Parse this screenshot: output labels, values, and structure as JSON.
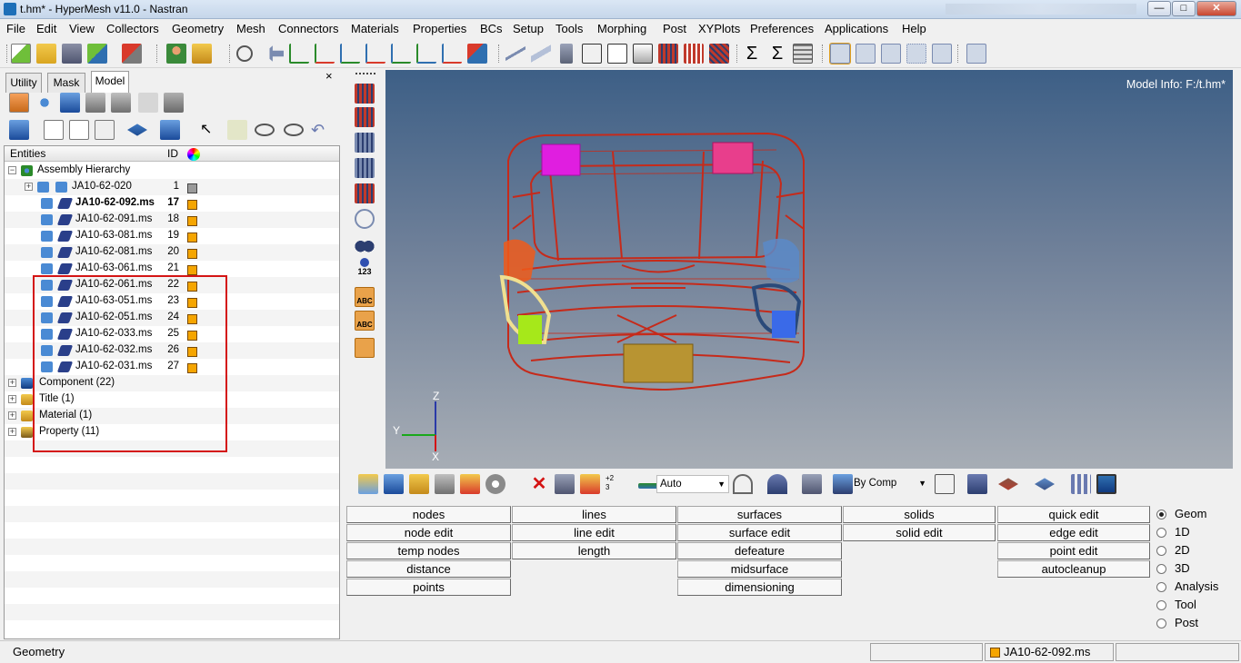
{
  "window": {
    "title": "t.hm* - HyperMesh v11.0 - Nastran",
    "minimize": "—",
    "maximize": "□",
    "close": "✕"
  },
  "menu": [
    "File",
    "Edit",
    "View",
    "Collectors",
    "Geometry",
    "Mesh",
    "Connectors",
    "Materials",
    "Properties",
    "BCs",
    "Setup",
    "Tools",
    "Morphing",
    "Post",
    "XYPlots",
    "Preferences",
    "Applications",
    "Help"
  ],
  "tabs": {
    "utility": "Utility",
    "mask": "Mask",
    "model": "Model",
    "close": "×"
  },
  "tree": {
    "headers": {
      "entities": "Entities",
      "id": "ID"
    },
    "root": "Assembly Hierarchy",
    "top_assembly": {
      "name": "JA10-62-020",
      "id": "1",
      "color": "#9a9a9a"
    },
    "children": [
      {
        "name": "JA10-62-092.ms",
        "id": "17"
      },
      {
        "name": "JA10-62-091.ms",
        "id": "18"
      },
      {
        "name": "JA10-63-081.ms",
        "id": "19"
      },
      {
        "name": "JA10-62-081.ms",
        "id": "20"
      },
      {
        "name": "JA10-63-061.ms",
        "id": "21"
      },
      {
        "name": "JA10-62-061.ms",
        "id": "22"
      },
      {
        "name": "JA10-63-051.ms",
        "id": "23"
      },
      {
        "name": "JA10-62-051.ms",
        "id": "24"
      },
      {
        "name": "JA10-62-033.ms",
        "id": "25"
      },
      {
        "name": "JA10-62-032.ms",
        "id": "26"
      },
      {
        "name": "JA10-62-031.ms",
        "id": "27"
      }
    ],
    "groups": [
      "Component (22)",
      "Title (1)",
      "Material (1)",
      "Property (11)"
    ],
    "swatch_color": "#f5a500",
    "selection_color": "#d41414"
  },
  "viewport": {
    "model_info": "Model Info: F:/t.hm*",
    "axes": {
      "x": "X",
      "y": "Y",
      "z": "Z"
    },
    "vt_label": "123",
    "abc1": "ABC",
    "abc2": "ABC"
  },
  "viewbar": {
    "auto_label": "Auto",
    "by_comp_label": "By Comp",
    "node_label": "+2\n3"
  },
  "panel": {
    "col1": [
      "nodes",
      "node edit",
      "temp nodes",
      "distance",
      "points"
    ],
    "col2": [
      "lines",
      "line edit",
      "length"
    ],
    "col3": [
      "surfaces",
      "surface edit",
      "defeature",
      "midsurface",
      "dimensioning"
    ],
    "col4": [
      "solids",
      "solid edit"
    ],
    "col5": [
      "quick edit",
      "edge edit",
      "point edit",
      "autocleanup"
    ],
    "radios": [
      "Geom",
      "1D",
      "2D",
      "3D",
      "Analysis",
      "Tool",
      "Post"
    ],
    "selected_radio": "Geom"
  },
  "status": {
    "left": "Geometry",
    "current_component": "JA10-62-092.ms"
  }
}
